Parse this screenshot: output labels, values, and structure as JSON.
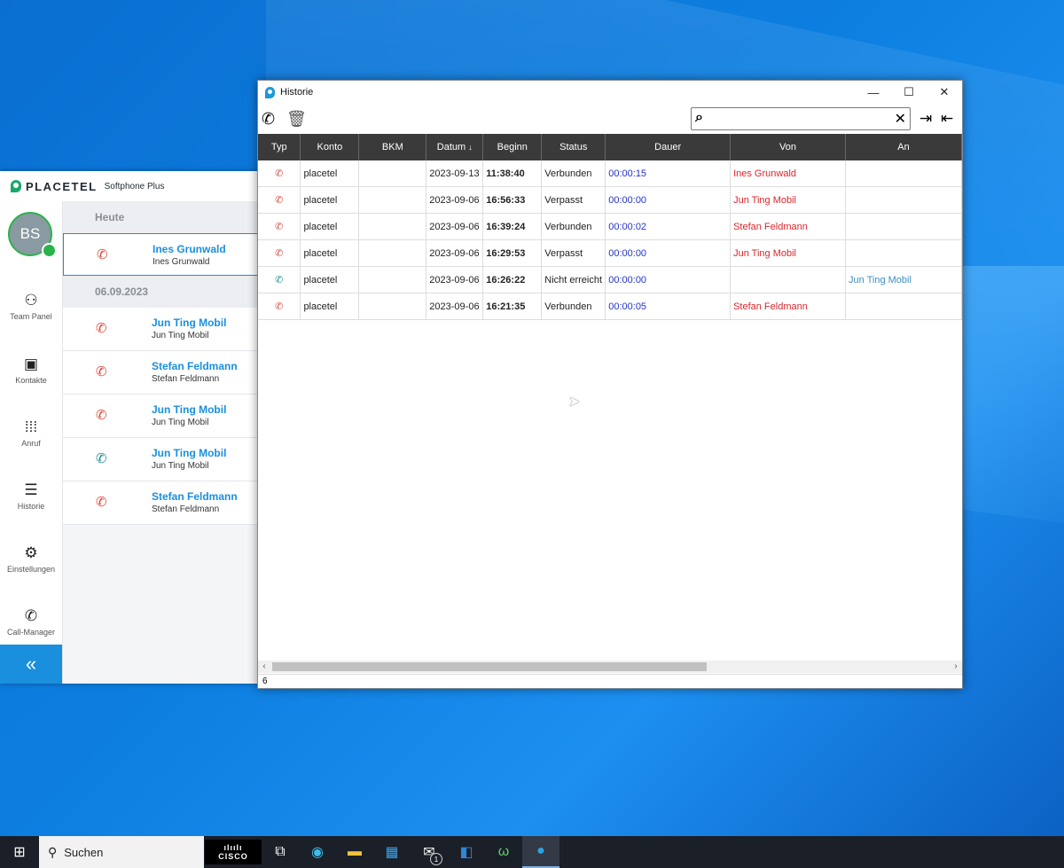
{
  "softphone": {
    "brand": "PLACETEL",
    "subtitle": "Softphone Plus",
    "avatar_initials": "BS",
    "nav": [
      {
        "label": "Team Panel",
        "icon": "team-icon"
      },
      {
        "label": "Kontakte",
        "icon": "contacts-icon"
      },
      {
        "label": "Anruf",
        "icon": "dialpad-icon"
      },
      {
        "label": "Historie",
        "icon": "history-list-icon"
      },
      {
        "label": "Einstellungen",
        "icon": "gear-icon"
      },
      {
        "label": "Call-Manager",
        "icon": "call-manager-icon"
      }
    ],
    "collapse_glyph": "«",
    "groups": [
      {
        "header": "Heute",
        "items": [
          {
            "name": "Ines Grunwald",
            "sub": "Ines Grunwald",
            "type": "incoming"
          }
        ]
      },
      {
        "header": "06.09.2023",
        "items": [
          {
            "name": "Jun Ting Mobil",
            "sub": "Jun Ting Mobil",
            "type": "incoming"
          },
          {
            "name": "Stefan Feldmann",
            "sub": "Stefan Feldmann",
            "type": "incoming"
          },
          {
            "name": "Jun Ting Mobil",
            "sub": "Jun Ting Mobil",
            "type": "incoming"
          },
          {
            "name": "Jun Ting Mobil",
            "sub": "Jun Ting Mobil",
            "type": "outgoing"
          },
          {
            "name": "Stefan Feldmann",
            "sub": "Stefan Feldmann",
            "type": "incoming"
          }
        ]
      }
    ]
  },
  "historie": {
    "title": "Historie",
    "window_buttons": {
      "minimize": "—",
      "maximize": "☐",
      "close": "✕"
    },
    "search": {
      "value": "",
      "placeholder": ""
    },
    "columns": [
      "Typ",
      "Konto",
      "BKM",
      "Datum",
      "Beginn",
      "Status",
      "Dauer",
      "Von",
      "An"
    ],
    "sort_indicator": "↓",
    "rows": [
      {
        "type": "incoming",
        "konto": "placetel",
        "bkm": "",
        "datum": "2023-09-13",
        "beginn": "11:38:40",
        "status": "Verbunden",
        "dauer": "00:00:15",
        "von": "Ines Grunwald",
        "an": ""
      },
      {
        "type": "incoming",
        "konto": "placetel",
        "bkm": "",
        "datum": "2023-09-06",
        "beginn": "16:56:33",
        "status": "Verpasst",
        "dauer": "00:00:00",
        "von": "Jun Ting Mobil",
        "an": ""
      },
      {
        "type": "incoming",
        "konto": "placetel",
        "bkm": "",
        "datum": "2023-09-06",
        "beginn": "16:39:24",
        "status": "Verbunden",
        "dauer": "00:00:02",
        "von": "Stefan Feldmann",
        "an": ""
      },
      {
        "type": "incoming",
        "konto": "placetel",
        "bkm": "",
        "datum": "2023-09-06",
        "beginn": "16:29:53",
        "status": "Verpasst",
        "dauer": "00:00:00",
        "von": "Jun Ting Mobil",
        "an": ""
      },
      {
        "type": "outgoing",
        "konto": "placetel",
        "bkm": "",
        "datum": "2023-09-06",
        "beginn": "16:26:22",
        "status": "Nicht erreicht",
        "dauer": "00:00:00",
        "von": "",
        "an": "Jun Ting Mobil"
      },
      {
        "type": "incoming",
        "konto": "placetel",
        "bkm": "",
        "datum": "2023-09-06",
        "beginn": "16:21:35",
        "status": "Verbunden",
        "dauer": "00:00:05",
        "von": "Stefan Feldmann",
        "an": ""
      }
    ],
    "status_count": "6"
  },
  "taskbar": {
    "search_label": "Suchen",
    "cisco_label": "CISCO",
    "mail_badge": "1"
  },
  "colors": {
    "accent": "#1a8fdd",
    "missed_red": "#e0463a",
    "outgoing_teal": "#1b8c9a",
    "duration_blue": "#2233cc"
  }
}
